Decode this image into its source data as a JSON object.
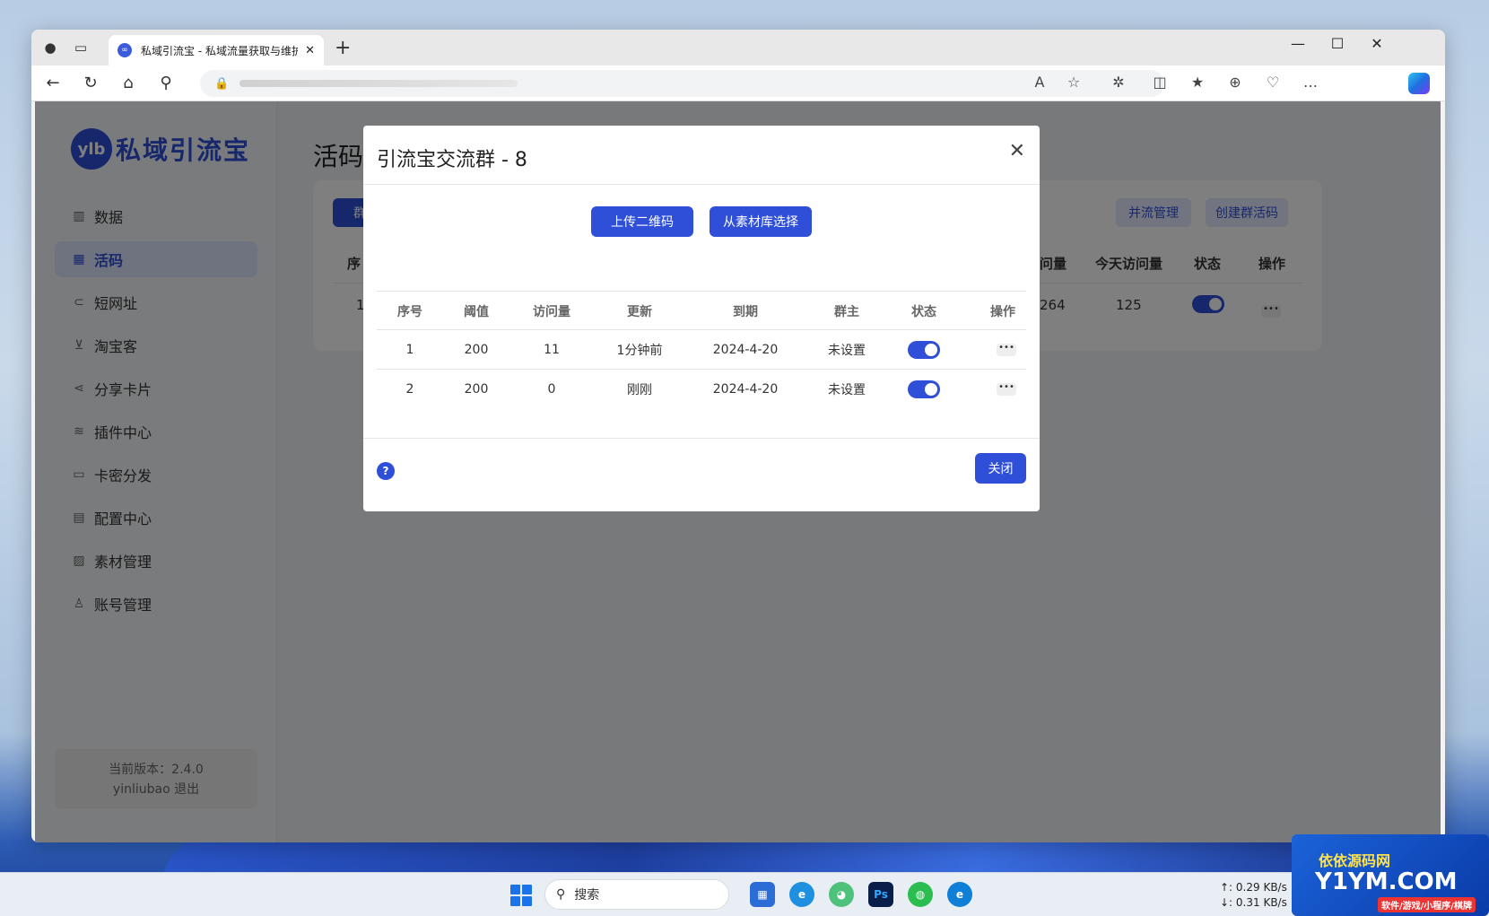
{
  "browser": {
    "tab_title": "私域引流宝 - 私域流量获取与维护",
    "tab_favicon": "∞",
    "new_tab": "+",
    "minimize": "—",
    "maximize": "☐",
    "close": "✕"
  },
  "sidebar": {
    "logo_badge": "ylb",
    "logo_text": "私域引流宝",
    "items": [
      {
        "label": "数据",
        "icon": "chart-icon"
      },
      {
        "label": "活码",
        "icon": "grid-icon"
      },
      {
        "label": "短网址",
        "icon": "link-icon"
      },
      {
        "label": "淘宝客",
        "icon": "cart-icon"
      },
      {
        "label": "分享卡片",
        "icon": "share-icon"
      },
      {
        "label": "插件中心",
        "icon": "layers-icon"
      },
      {
        "label": "卡密分发",
        "icon": "card-icon"
      },
      {
        "label": "配置中心",
        "icon": "config-icon"
      },
      {
        "label": "素材管理",
        "icon": "image-icon"
      },
      {
        "label": "账号管理",
        "icon": "user-icon"
      }
    ],
    "version": "当前版本：2.4.0",
    "user": "yinliubao 退出"
  },
  "main": {
    "page_title": "活码",
    "tab_group": "群",
    "btn_flow_manage": "并流管理",
    "btn_create_group": "创建群活码",
    "col_seq": "序",
    "col_visits": "问量",
    "col_today_visits": "今天访问量",
    "col_status": "状态",
    "col_ops": "操作",
    "row_seq": "1",
    "row_visits": "264",
    "row_today": "125"
  },
  "modal": {
    "title": "引流宝交流群 - 8",
    "close_icon": "✕",
    "btn_upload": "上传二维码",
    "btn_library": "从素材库选择",
    "headers": [
      "序号",
      "阈值",
      "访问量",
      "更新",
      "到期",
      "群主",
      "状态",
      "操作"
    ],
    "rows": [
      {
        "seq": "1",
        "threshold": "200",
        "visits": "11",
        "updated": "1分钟前",
        "expire": "2024-4-20",
        "owner": "未设置",
        "status": true
      },
      {
        "seq": "2",
        "threshold": "200",
        "visits": "0",
        "updated": "刚刚",
        "expire": "2024-4-20",
        "owner": "未设置",
        "status": true
      }
    ],
    "help": "?",
    "btn_close": "关闭"
  },
  "taskbar": {
    "search_placeholder": "搜索",
    "net_up": "↑: 0.29 KB/s",
    "net_down": "↓: 0.31 KB/s",
    "watermark_1": "依依源码网",
    "watermark_2": "Y1YM.COM",
    "watermark_3": "软件/游戏/小程序/棋牌"
  },
  "colors": {
    "accent": "#2f4fd8",
    "overlay": "rgba(0,0,0,0.5)"
  }
}
